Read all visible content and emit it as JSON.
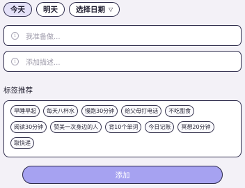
{
  "date_selector": {
    "today": "今天",
    "tomorrow": "明天",
    "pick_date": "选择日期",
    "pick_icon": "triangle-down-icon"
  },
  "fields": {
    "title_placeholder": "我准备做...",
    "desc_placeholder": "添加描述..."
  },
  "tags": {
    "heading": "标签推荐",
    "rows": [
      [
        "早睡早起",
        "每天八杯水",
        "慢跑30分钟",
        "给父母打电话",
        "不吃甜食"
      ],
      [
        "阅读30分钟",
        "赞美一次身边的人",
        "背10个单词",
        "今日记账",
        "冥想20分钟"
      ],
      [
        "取快递"
      ]
    ]
  },
  "actions": {
    "add_label": "添加"
  },
  "colors": {
    "accent": "#a6a2f1",
    "border": "#2c2a4a",
    "background": "#f3f1f7"
  }
}
